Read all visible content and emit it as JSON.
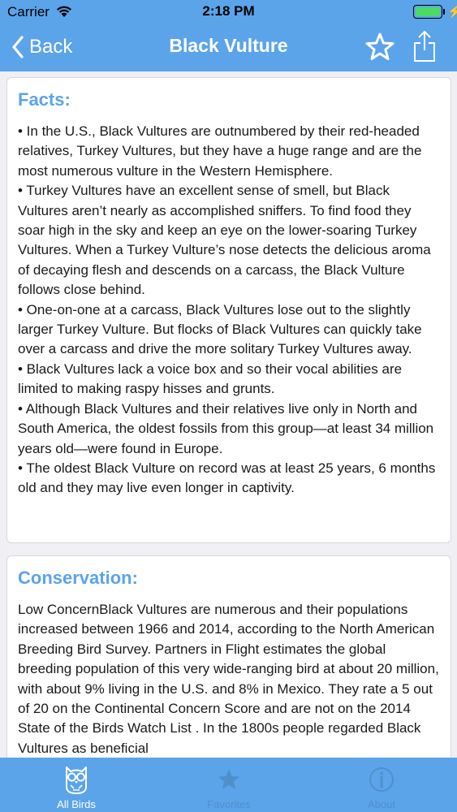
{
  "status_bar": {
    "carrier": "Carrier",
    "time": "2:18 PM",
    "battery_color": "#4cd964"
  },
  "nav": {
    "back_label": "Back",
    "title": "Black Vulture",
    "star_icon": "star-outline-icon",
    "share_icon": "share-icon",
    "bar_color": "#5ba4ea"
  },
  "facts": {
    "heading": "Facts:",
    "body": "• In the U.S., Black Vultures are outnumbered by their red-headed relatives, Turkey Vultures, but they have a huge range and are the most numerous vulture in the Western Hemisphere.\n• Turkey Vultures have an excellent sense of smell, but Black Vultures aren’t nearly as accomplished sniffers. To find food they soar high in the sky and keep an eye on the lower-soaring Turkey Vultures. When a Turkey Vulture’s nose detects the delicious aroma of decaying flesh and descends on a carcass, the Black Vulture follows close behind.\n• One-on-one at a carcass, Black Vultures lose out to the slightly larger Turkey Vulture. But flocks of Black Vultures can quickly take over a carcass and drive the more solitary Turkey Vultures away.\n• Black Vultures lack a voice box and so their vocal abilities are limited to making raspy hisses and grunts.\n• Although Black Vultures and their relatives live only in North and South America, the oldest fossils from this group—at least 34 million years old—were found in Europe.\n• The oldest Black Vulture on record was at least 25 years, 6 months old and they may live even longer in captivity."
  },
  "conservation": {
    "heading": "Conservation:",
    "body": "Low ConcernBlack Vultures are numerous and their populations increased between 1966 and 2014, according to the North American Breeding Bird Survey. Partners in Flight estimates the global breeding population of this very wide-ranging bird at about 20 million, with about 9% living in the U.S. and 8% in Mexico. They rate a 5 out of 20 on the Continental Concern Score and are not on the 2014 State of the Birds Watch List . In the 1800s people regarded Black Vultures as beneficial"
  },
  "tabs": [
    {
      "label": "All Birds",
      "icon": "owl-icon",
      "active": true
    },
    {
      "label": "Favorites",
      "icon": "star-icon",
      "active": false
    },
    {
      "label": "About",
      "icon": "info-icon",
      "active": false
    }
  ],
  "colors": {
    "accent": "#5ba4ea",
    "background": "#efeff4",
    "tab_inactive": "#4f8fcc"
  }
}
